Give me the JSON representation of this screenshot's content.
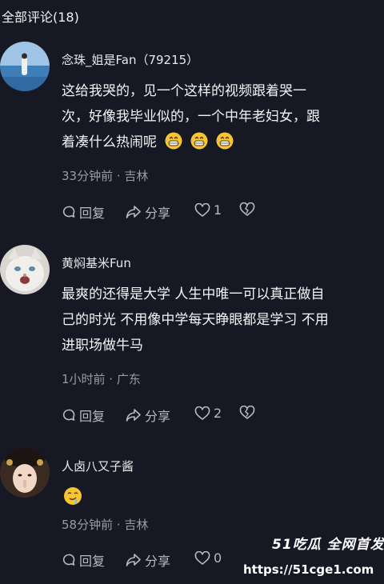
{
  "header": {
    "title": "全部评论(18)"
  },
  "comments": [
    {
      "name": "念珠_姐是Fan（79215）",
      "lines": [
        "这给我哭的，见一个这样的视频跟着哭一",
        "次，好像我毕业似的，一个中年老妇女，跟",
        "着凑什么热闹呢"
      ],
      "meta": "33分钟前 · 吉林",
      "reply": "回复",
      "share": "分享",
      "likes": "1"
    },
    {
      "name": "黄焖基米Fun",
      "lines": [
        "最爽的还得是大学 人生中唯一可以真正做自",
        "己的时光 不用像中学每天睁眼都是学习 不用",
        "进职场做牛马"
      ],
      "meta": "1小时前 · 广东",
      "reply": "回复",
      "share": "分享",
      "likes": "2"
    },
    {
      "name": "人卤八又子酱",
      "lines": [],
      "meta": "58分钟前 · 吉林",
      "reply": "回复",
      "share": "分享",
      "likes": "0"
    }
  ],
  "watermark": {
    "line1": "51吃瓜 全网首发",
    "line2": "https://51cge1.com"
  },
  "icons": [
    "comment-icon",
    "share-icon",
    "heart-icon",
    "dislike-heart-icon",
    "grin-emoji-icon",
    "drool-emoji-icon"
  ]
}
